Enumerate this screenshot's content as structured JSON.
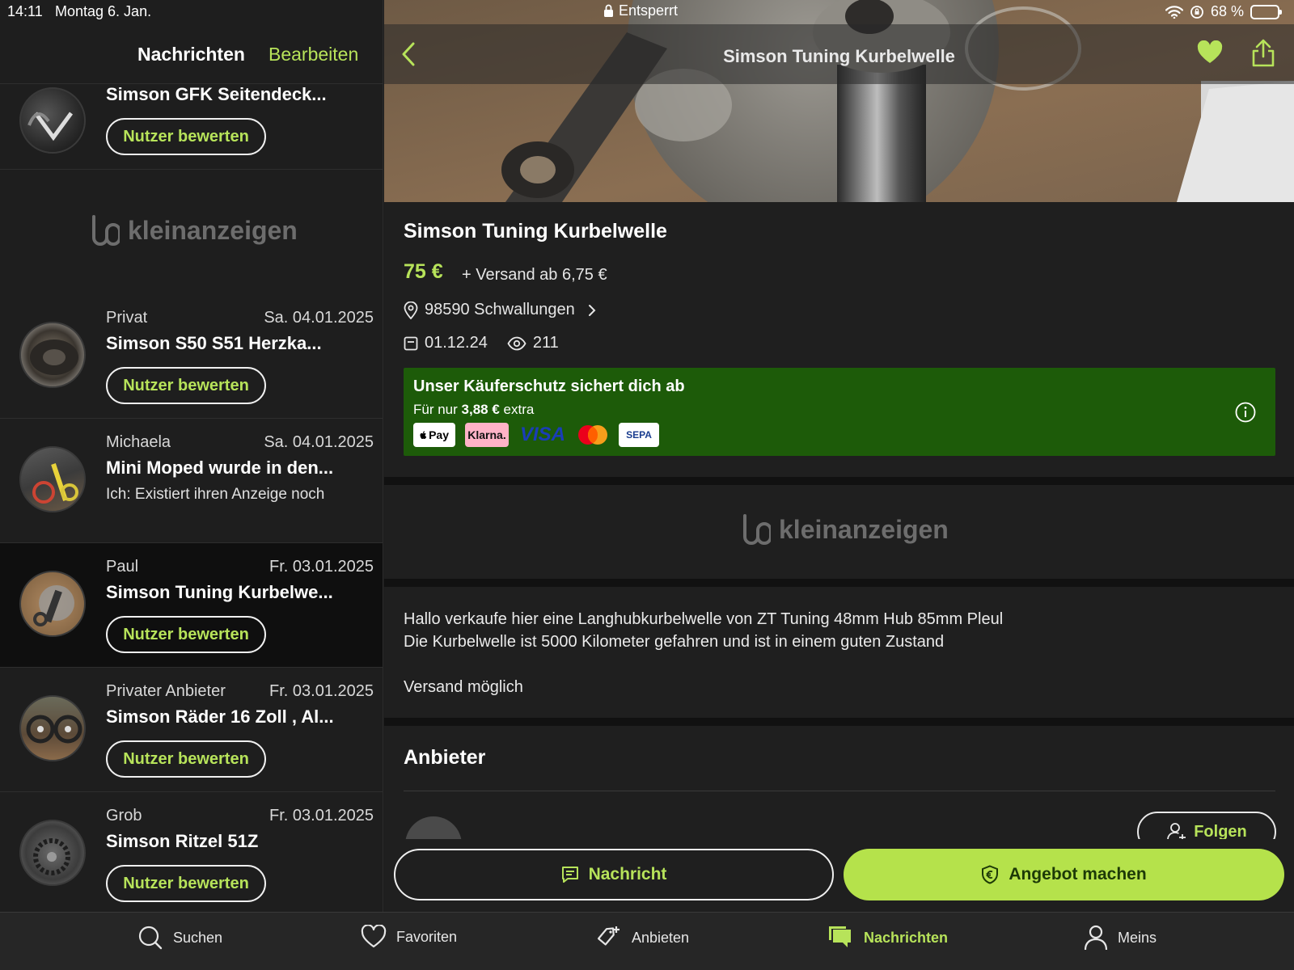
{
  "status_bar": {
    "time": "14:11",
    "date": "Montag 6. Jan.",
    "lock_label": "Entsperrt",
    "battery": "68 %",
    "battery_level": 0.68
  },
  "messages": {
    "title": "Nachrichten",
    "edit_label": "Bearbeiten",
    "rate_label": "Nutzer bewerten",
    "brand": "kleinanzeigen",
    "conversations": [
      {
        "sender": "",
        "date": "",
        "title": "Simson GFK Seitendeck...",
        "preview": ""
      },
      {
        "sender": "Privat",
        "date": "Sa. 04.01.2025",
        "title": "Simson S50 S51 Herzka...",
        "preview": ""
      },
      {
        "sender": "Michaela",
        "date": "Sa. 04.01.2025",
        "title": "Mini Moped wurde in den...",
        "preview": "Ich: Existiert ihren Anzeige noch"
      },
      {
        "sender": "Paul",
        "date": "Fr. 03.01.2025",
        "title": "Simson Tuning Kurbelwe...",
        "preview": ""
      },
      {
        "sender": "Privater Anbieter",
        "date": "Fr. 03.01.2025",
        "title": "Simson Räder 16 Zoll , Al...",
        "preview": ""
      },
      {
        "sender": "Grob",
        "date": "Fr. 03.01.2025",
        "title": "Simson Ritzel 51Z",
        "preview": ""
      }
    ]
  },
  "listing": {
    "nav_title": "Simson Tuning Kurbelwelle",
    "title": "Simson Tuning Kurbelwelle",
    "price": "75 €",
    "shipping": "+ Versand ab 6,75 €",
    "location": "98590 Schwallungen",
    "date": "01.12.24",
    "views": "211",
    "protection": {
      "title": "Unser Käuferschutz sichert dich ab",
      "sub_prefix": "Für nur",
      "sub_amount": "3,88 €",
      "sub_suffix": "extra",
      "payment_methods": [
        "Pay",
        "Klarna.",
        "VISA",
        "SEPA"
      ]
    },
    "brand": "kleinanzeigen",
    "description": [
      "Hallo verkaufe hier eine Langhubkurbelwelle von ZT Tuning 48mm Hub 85mm Pleul",
      "Die Kurbelwelle ist 5000 Kilometer gefahren und ist in einem guten Zustand",
      "",
      "Versand möglich"
    ],
    "seller_heading": "Anbieter",
    "follow_label": "Folgen",
    "message_button": "Nachricht",
    "offer_button": "Angebot machen"
  },
  "tabbar": {
    "items": [
      {
        "label": "Suchen",
        "icon": "search-icon"
      },
      {
        "label": "Favoriten",
        "icon": "heart-icon"
      },
      {
        "label": "Anbieten",
        "icon": "add-tag-icon"
      },
      {
        "label": "Nachrichten",
        "icon": "chat-icon"
      },
      {
        "label": "Meins",
        "icon": "person-icon"
      }
    ],
    "active": "Nachrichten"
  },
  "colors": {
    "accent": "#b7e35a",
    "offer_button": "#b5e24b",
    "protection_bg": "#1d5b09",
    "background": "#1d1d1d"
  }
}
